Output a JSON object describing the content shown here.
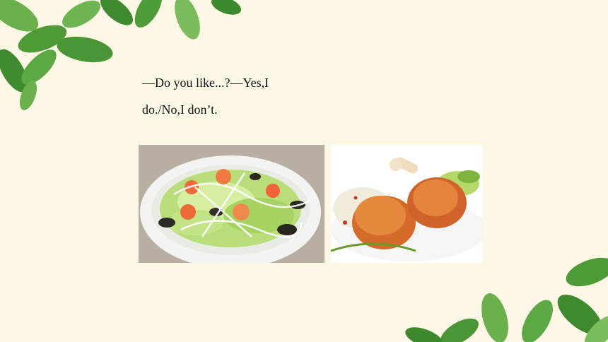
{
  "slide": {
    "background_color": "#fdf8e6",
    "leaf_color": "#4e9a3a",
    "text_lines": [
      "—Do you like...?—Yes,I",
      "do./No,I don’t."
    ]
  },
  "images": [
    {
      "id": "salad",
      "icon": "salad-photo"
    },
    {
      "id": "chicken",
      "icon": "chicken-drumsticks-photo"
    }
  ]
}
